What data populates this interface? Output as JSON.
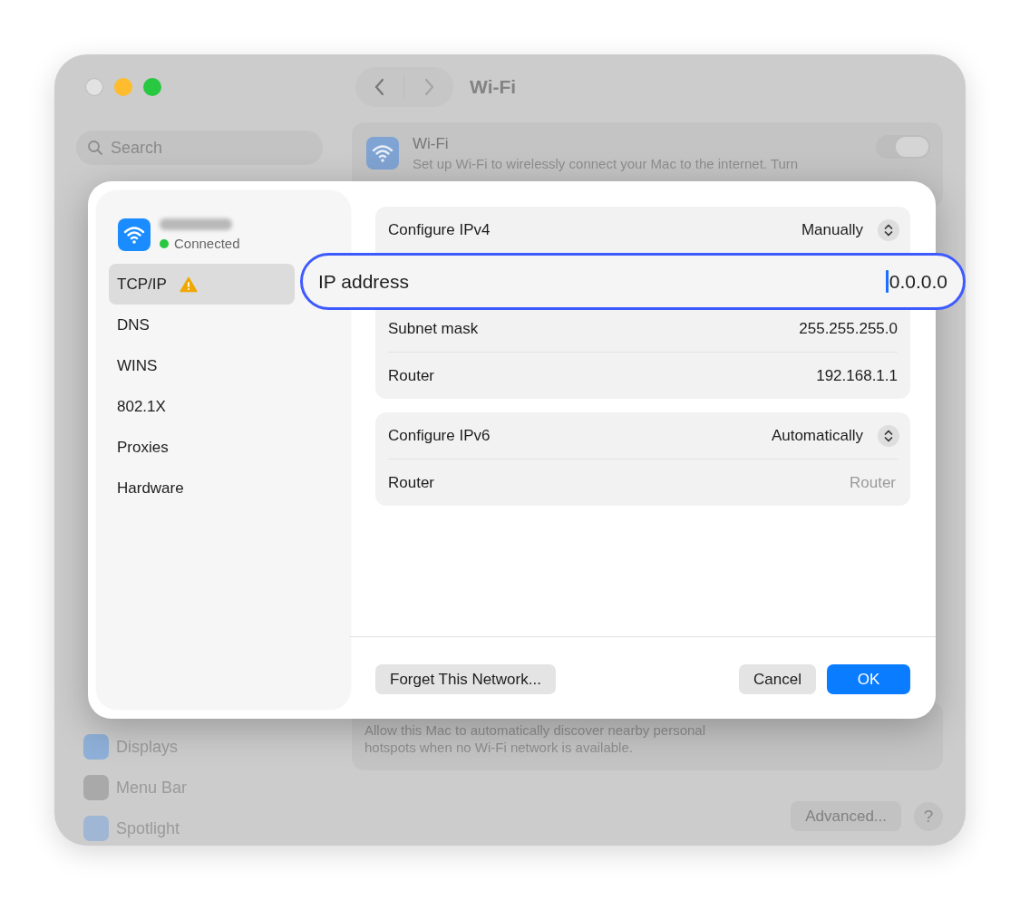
{
  "window": {
    "title": "Wi-Fi",
    "search": {
      "placeholder": "Search"
    },
    "sidebar": {
      "items": [
        {
          "label": "Displays",
          "color": "#8fb0d8"
        },
        {
          "label": "Menu Bar",
          "color": "#a9a9a9"
        },
        {
          "label": "Spotlight",
          "color": "#9fb6d4"
        }
      ]
    },
    "wifi_card": {
      "title": "Wi-Fi",
      "description": "Set up Wi-Fi to wirelessly connect your Mac to the internet. Turn",
      "on": true
    },
    "hotspot_card": {
      "description": "Allow this Mac to automatically discover nearby personal hotspots when no Wi-Fi network is available."
    },
    "advanced_button": "Advanced...",
    "help_button": "?"
  },
  "dialog": {
    "network": {
      "status": "Connected",
      "connected": true
    },
    "tabs": [
      {
        "label": "TCP/IP",
        "selected": true,
        "warning": true
      },
      {
        "label": "DNS",
        "selected": false,
        "warning": false
      },
      {
        "label": "WINS",
        "selected": false,
        "warning": false
      },
      {
        "label": "802.1X",
        "selected": false,
        "warning": false
      },
      {
        "label": "Proxies",
        "selected": false,
        "warning": false
      },
      {
        "label": "Hardware",
        "selected": false,
        "warning": false
      }
    ],
    "ipv4": {
      "rows": [
        {
          "kind": "popup",
          "label": "Configure IPv4",
          "value": "Manually"
        },
        {
          "kind": "focus",
          "label": "IP address",
          "value": "0.0.0.0"
        },
        {
          "kind": "text",
          "label": "Subnet mask",
          "value": "255.255.255.0"
        },
        {
          "kind": "text",
          "label": "Router",
          "value": "192.168.1.1"
        }
      ]
    },
    "ipv6": {
      "rows": [
        {
          "kind": "popup",
          "label": "Configure IPv6",
          "value": "Automatically"
        },
        {
          "kind": "placeholder",
          "label": "Router",
          "placeholder": "Router"
        }
      ]
    },
    "buttons": {
      "forget": "Forget This Network...",
      "cancel": "Cancel",
      "ok": "OK"
    }
  }
}
